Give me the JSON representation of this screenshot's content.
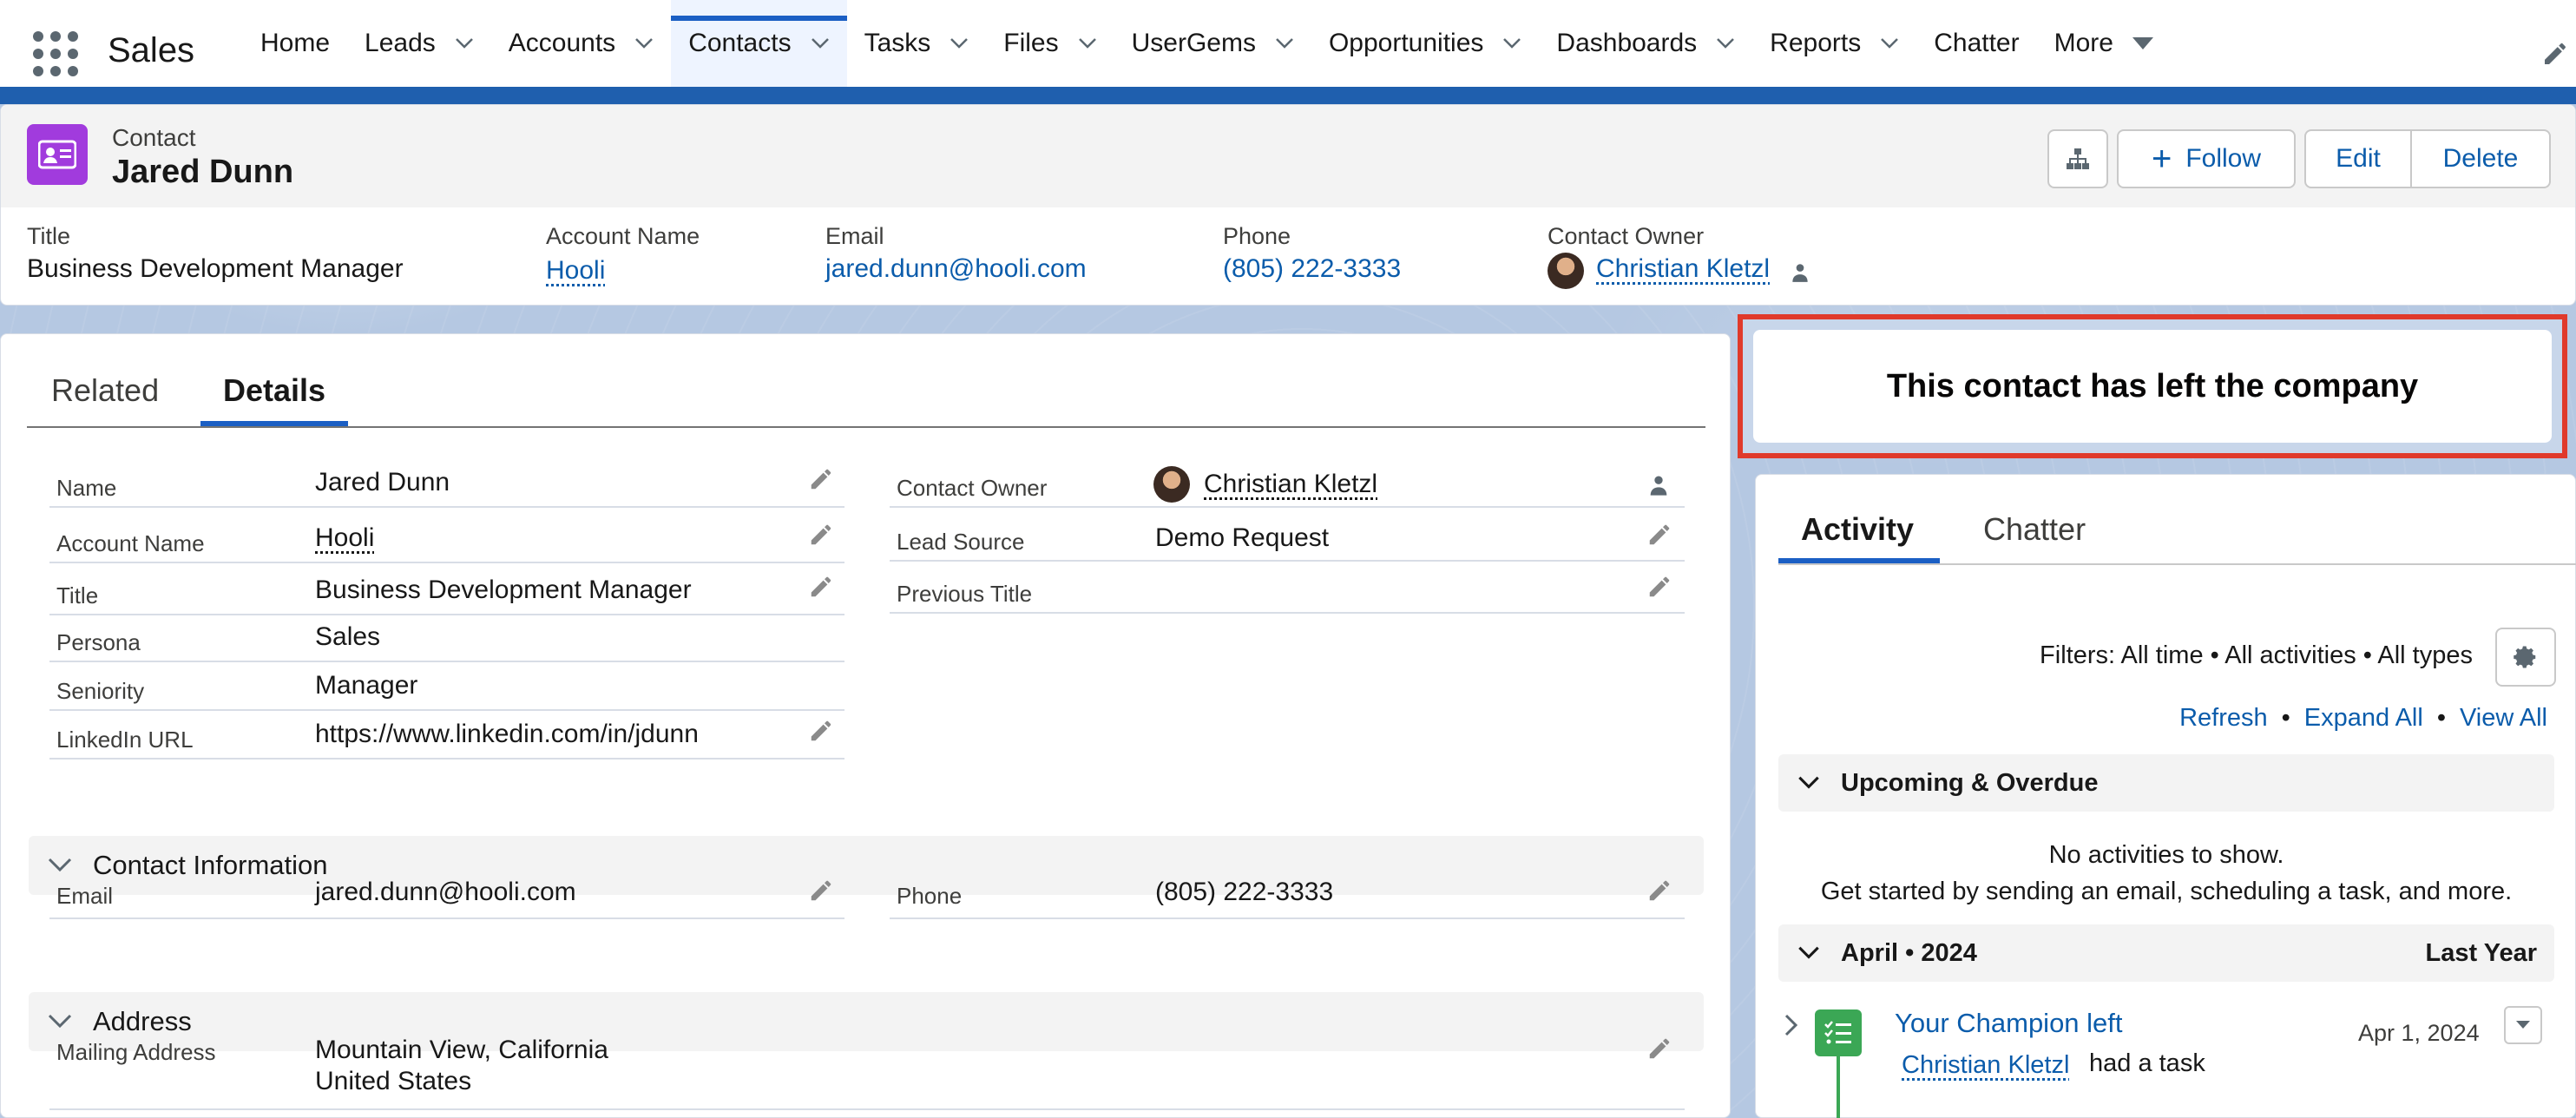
{
  "app": {
    "name": "Sales",
    "tabs": [
      {
        "label": "Home",
        "dropdown": false
      },
      {
        "label": "Leads",
        "dropdown": true
      },
      {
        "label": "Accounts",
        "dropdown": true
      },
      {
        "label": "Contacts",
        "dropdown": true,
        "active": true
      },
      {
        "label": "Tasks",
        "dropdown": true
      },
      {
        "label": "Files",
        "dropdown": true
      },
      {
        "label": "UserGems",
        "dropdown": true
      },
      {
        "label": "Opportunities",
        "dropdown": true
      },
      {
        "label": "Dashboards",
        "dropdown": true
      },
      {
        "label": "Reports",
        "dropdown": true
      },
      {
        "label": "Chatter",
        "dropdown": false
      },
      {
        "label": "More",
        "dropdown": true
      }
    ]
  },
  "header": {
    "object_type": "Contact",
    "name": "Jared Dunn",
    "follow_label": "Follow",
    "edit_label": "Edit",
    "delete_label": "Delete",
    "fields": {
      "title_label": "Title",
      "title_value": "Business Development Manager",
      "account_label": "Account Name",
      "account_value": "Hooli",
      "email_label": "Email",
      "email_value": "jared.dunn@hooli.com",
      "phone_label": "Phone",
      "phone_value": "(805) 222-3333",
      "owner_label": "Contact Owner",
      "owner_value": "Christian Kletzl"
    }
  },
  "details": {
    "tabs": {
      "related": "Related",
      "details": "Details"
    },
    "left_fields": [
      {
        "label": "Name",
        "value": "Jared Dunn"
      },
      {
        "label": "Account Name",
        "value": "Hooli"
      },
      {
        "label": "Title",
        "value": "Business Development Manager"
      },
      {
        "label": "Persona",
        "value": "Sales"
      },
      {
        "label": "Seniority",
        "value": "Manager"
      },
      {
        "label": "LinkedIn URL",
        "value": "https://www.linkedin.com/in/jdunn"
      }
    ],
    "right_fields": [
      {
        "label": "Contact Owner",
        "value": "Christian Kletzl"
      },
      {
        "label": "Lead Source",
        "value": "Demo Request"
      },
      {
        "label": "Previous Title",
        "value": ""
      }
    ],
    "contact_info": {
      "title": "Contact Information",
      "email_label": "Email",
      "email_value": "jared.dunn@hooli.com",
      "phone_label": "Phone",
      "phone_value": "(805) 222-3333"
    },
    "address": {
      "title": "Address",
      "mailing_label": "Mailing Address",
      "line1": "Mountain View, California",
      "line2": "United States"
    }
  },
  "banner": {
    "text": "This contact has left the company"
  },
  "activity": {
    "tabs": {
      "activity": "Activity",
      "chatter": "Chatter"
    },
    "filters": "Filters: All time • All activities • All types",
    "links": {
      "refresh": "Refresh",
      "expand": "Expand All",
      "view_all": "View All"
    },
    "upcoming": {
      "title": "Upcoming & Overdue",
      "empty_line1": "No activities to show.",
      "empty_line2": "Get started by sending an email, scheduling a task, and more."
    },
    "month": {
      "title": "April • 2024",
      "right": "Last Year"
    },
    "item": {
      "title": "Your Champion left",
      "date": "Apr 1, 2024",
      "actor": "Christian Kletzl",
      "suffix": "had a task"
    }
  },
  "colors": {
    "brand_blue": "#1b5fc4",
    "link": "#0b5cab",
    "contact_icon": "#a13bdd",
    "task_green": "#3ba755",
    "banner_border": "#e03a2b"
  }
}
